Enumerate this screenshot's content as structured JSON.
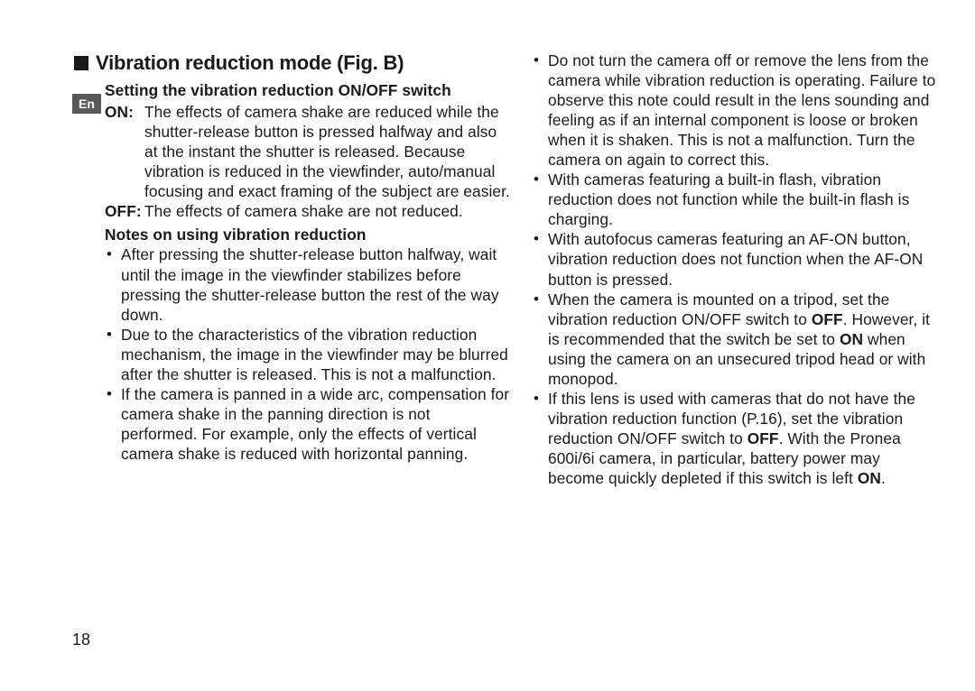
{
  "langTab": "En",
  "heading": "Vibration reduction mode (Fig. B)",
  "subhead": "Setting the vibration reduction ON/OFF switch",
  "defs": {
    "on": {
      "label": "ON:",
      "text": "The effects of camera shake are reduced while the shutter-release button is pressed halfway and also at the instant the shutter is released. Because vibration is reduced in the viewfinder, auto/manual focusing and exact framing of the subject are easier."
    },
    "off": {
      "label": "OFF:",
      "text": "The effects of camera shake are not reduced."
    }
  },
  "notesHead": "Notes on using vibration reduction",
  "notesLeft": [
    "After pressing the shutter-release button halfway, wait until the image in the viewfinder stabilizes before pressing the shutter-release button the rest of the way down.",
    "Due to the characteristics of the vibration reduction mechanism, the image in the viewfinder may be blurred after the shutter is released. This is not a malfunction.",
    "If the camera is panned in a wide arc, compensation for camera shake in the panning direction is not performed. For example, only the effects of vertical camera shake is reduced with horizontal panning."
  ],
  "notesRight": [
    {
      "pre": "Do not turn the camera off or remove the lens from the camera while vibration reduction is operating. Failure to observe this note could result in the lens sounding and feeling as if an internal component is loose or broken when it is shaken. This is not a malfunction. Turn the camera on again to correct this."
    },
    {
      "pre": "With cameras featuring a built-in flash, vibration reduction does not function while the built-in flash is charging."
    },
    {
      "pre": "With autofocus cameras featuring an AF-ON button, vibration reduction does not function when the AF-ON button is pressed."
    },
    {
      "pre": "When the camera is mounted on a tripod, set the vibration reduction ON/OFF switch to ",
      "b1": "OFF",
      "mid": ". However, it is recommended that the switch be set to ",
      "b2": "ON",
      "post": " when using the camera on an unsecured tripod head or with monopod."
    },
    {
      "pre": "If this lens is used with cameras that do not have the vibration reduction function (P.16), set the vibration reduction ON/OFF switch to ",
      "b1": "OFF",
      "mid": ". With the Pronea 600i/6i camera, in particular, battery power may become quickly depleted if this switch is left ",
      "b2": "ON",
      "post": "."
    }
  ],
  "pageNumber": "18"
}
